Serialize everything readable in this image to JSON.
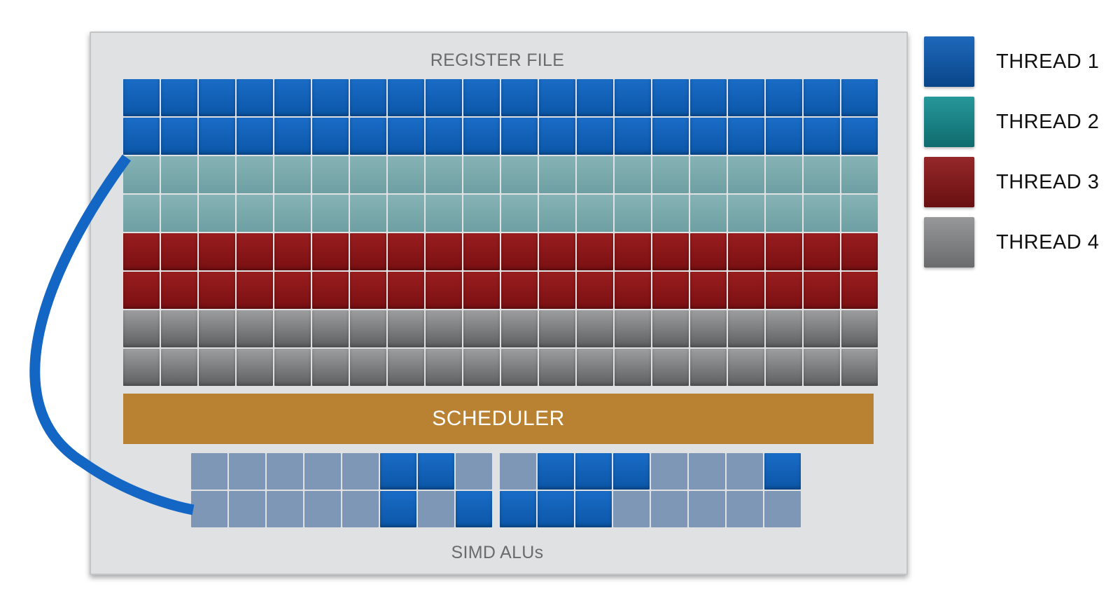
{
  "register_file": {
    "title": "REGISTER FILE",
    "columns": 20,
    "rows": [
      "thread-1",
      "thread-1",
      "thread-2",
      "thread-2",
      "thread-3",
      "thread-3",
      "thread-4",
      "thread-4"
    ]
  },
  "scheduler": {
    "label": "SCHEDULER"
  },
  "simd": {
    "title": "SIMD ALUs",
    "group_a": [
      [
        0,
        0,
        0,
        0,
        0,
        1,
        1,
        0
      ],
      [
        0,
        0,
        0,
        0,
        0,
        1,
        0,
        1
      ]
    ],
    "group_b": [
      [
        0,
        1,
        1,
        1,
        0,
        0,
        0,
        1
      ],
      [
        1,
        1,
        1,
        0,
        0,
        0,
        0,
        0
      ]
    ]
  },
  "legend": [
    {
      "label": "THREAD 1",
      "key": "thread-1",
      "color": "#0b5cb5"
    },
    {
      "label": "THREAD 2",
      "key": "thread-2",
      "color": "#148f92"
    },
    {
      "label": "THREAD 3",
      "key": "thread-3",
      "color": "#8c1517"
    },
    {
      "label": "THREAD 4",
      "key": "thread-4",
      "color": "#8e8f91"
    }
  ],
  "colors": {
    "connector": "#1466c4",
    "scheduler": "#b98232",
    "panel": "#e0e1e3",
    "idle_alu": "#7f97b7"
  }
}
